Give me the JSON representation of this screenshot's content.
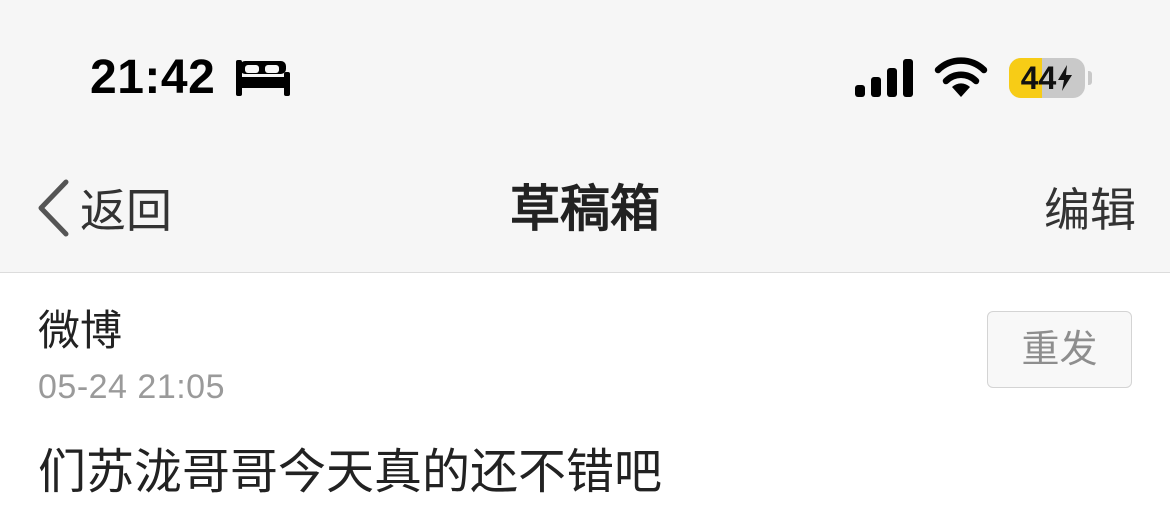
{
  "status_bar": {
    "time": "21:42",
    "focus_icon": "bed-icon",
    "signal_icon": "cellular-signal-icon",
    "wifi_icon": "wifi-icon",
    "battery_level": 44,
    "battery_label": "44",
    "charging": true,
    "battery_color": "#f7cc16"
  },
  "nav": {
    "back_label": "返回",
    "title": "草稿箱",
    "edit_label": "编辑"
  },
  "drafts": [
    {
      "source": "微博",
      "time": "05-24 21:05",
      "resend_label": "重发",
      "content": "们苏泷哥哥今天真的还不错吧"
    }
  ]
}
